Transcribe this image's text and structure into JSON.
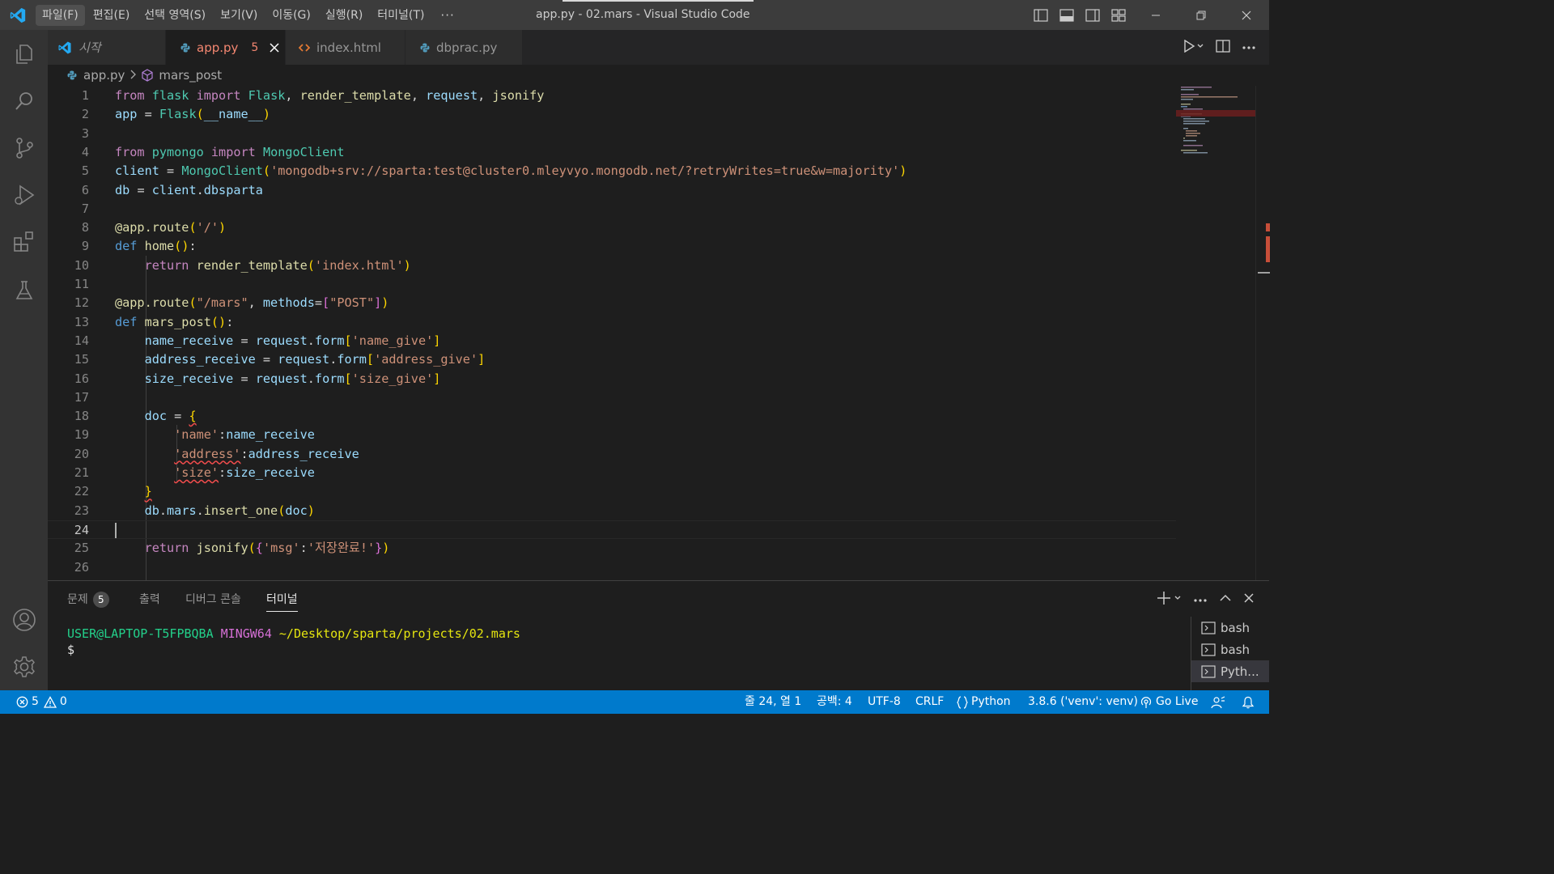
{
  "titlebar": {
    "menus": [
      "파일(F)",
      "편집(E)",
      "선택 영역(S)",
      "보기(V)",
      "이동(G)",
      "실행(R)",
      "터미널(T)"
    ],
    "more": "···",
    "window_title": "app.py - 02.mars - Visual Studio Code"
  },
  "tabs": [
    {
      "label": "시작"
    },
    {
      "label": "app.py",
      "badge": "5"
    },
    {
      "label": "index.html"
    },
    {
      "label": "dbprac.py"
    }
  ],
  "breadcrumb": {
    "file": "app.py",
    "symbol": "mars_post"
  },
  "editor": {
    "line_numbers": [
      "1",
      "2",
      "3",
      "4",
      "5",
      "6",
      "7",
      "8",
      "9",
      "10",
      "11",
      "12",
      "13",
      "14",
      "15",
      "16",
      "17",
      "18",
      "19",
      "20",
      "21",
      "22",
      "23",
      "24",
      "25",
      "26"
    ],
    "lines": [
      "from flask import Flask, render_template, request, jsonify",
      "app = Flask(__name__)",
      "",
      "from pymongo import MongoClient",
      "client = MongoClient('mongodb+srv://sparta:test@cluster0.mleyvyo.mongodb.net/?retryWrites=true&w=majority')",
      "db = client.dbsparta",
      "",
      "@app.route('/')",
      "def home():",
      "    return render_template('index.html')",
      "",
      "@app.route(\"/mars\", methods=[\"POST\"])",
      "def mars_post():",
      "    name_receive = request.form['name_give']",
      "    address_receive = request.form['address_give']",
      "    size_receive = request.form['size_give']",
      "",
      "    doc = {",
      "        'name':name_receive",
      "        'address':address_receive",
      "        'size':size_receive",
      "    }",
      "    db.mars.insert_one(doc)",
      "",
      "    return jsonify({'msg':'저장완료!'})",
      ""
    ]
  },
  "panel": {
    "tabs": [
      {
        "label": "문제",
        "badge": "5"
      },
      {
        "label": "출력"
      },
      {
        "label": "디버그 콘솔"
      },
      {
        "label": "터미널"
      }
    ],
    "terminal": {
      "user": "USER@LAPTOP-T5FPBQBA",
      "env": "MINGW64",
      "path": "~/Desktop/sparta/projects/02.mars",
      "prompt": "$"
    },
    "terminal_list": [
      "bash",
      "bash",
      "Pyth..."
    ]
  },
  "statusbar": {
    "errors": "5",
    "warnings": "0",
    "position": "줄 24, 열 1",
    "spaces": "공백: 4",
    "encoding": "UTF-8",
    "eol": "CRLF",
    "language": "Python",
    "interpreter": "3.8.6 ('venv': venv)",
    "golive": "Go Live"
  },
  "colors": {
    "statusbar": "#007acc",
    "titlebar": "#3c3c3c",
    "activitybar": "#333333",
    "editor": "#1e1e1e",
    "error": "#f48771"
  }
}
